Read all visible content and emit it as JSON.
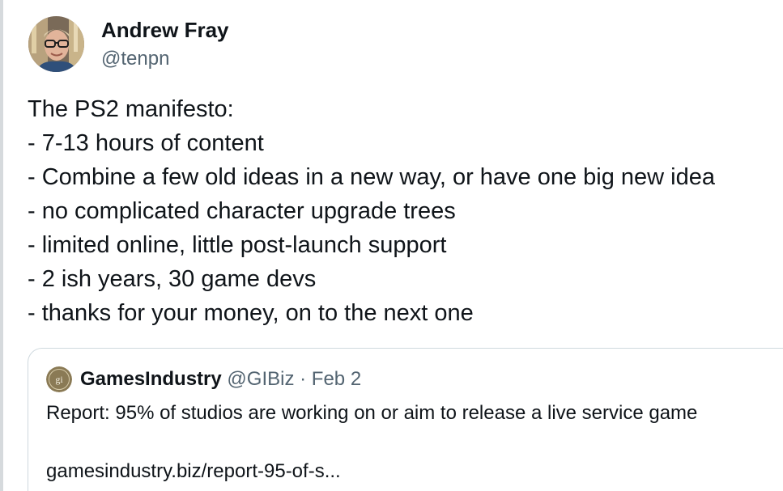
{
  "author": {
    "display_name": "Andrew Fray",
    "handle": "@tenpn",
    "avatar_icon": "profile-photo"
  },
  "tweet": {
    "lines": [
      "The PS2 manifesto:",
      "- 7-13 hours of content",
      "- Combine a few old ideas in a new way, or have one big new idea",
      "- no complicated character upgrade trees",
      "- limited online, little post-launch support",
      "- 2 ish years, 30 game devs",
      "- thanks for your money, on to the next one"
    ]
  },
  "quoted_tweet": {
    "display_name": "GamesIndustry",
    "handle": "@GIBiz",
    "separator": "·",
    "date": "Feb 2",
    "text": "Report: 95% of studios are working on or aim to release a live service game",
    "link": "gamesindustry.biz/report-95-of-s...",
    "avatar_icon": "gi-logo-icon",
    "avatar_letters": "gi"
  },
  "colors": {
    "text_primary": "#0f1419",
    "text_secondary": "#536471",
    "border": "#cfd9de",
    "gi_logo_bg": "#8a7a55"
  }
}
